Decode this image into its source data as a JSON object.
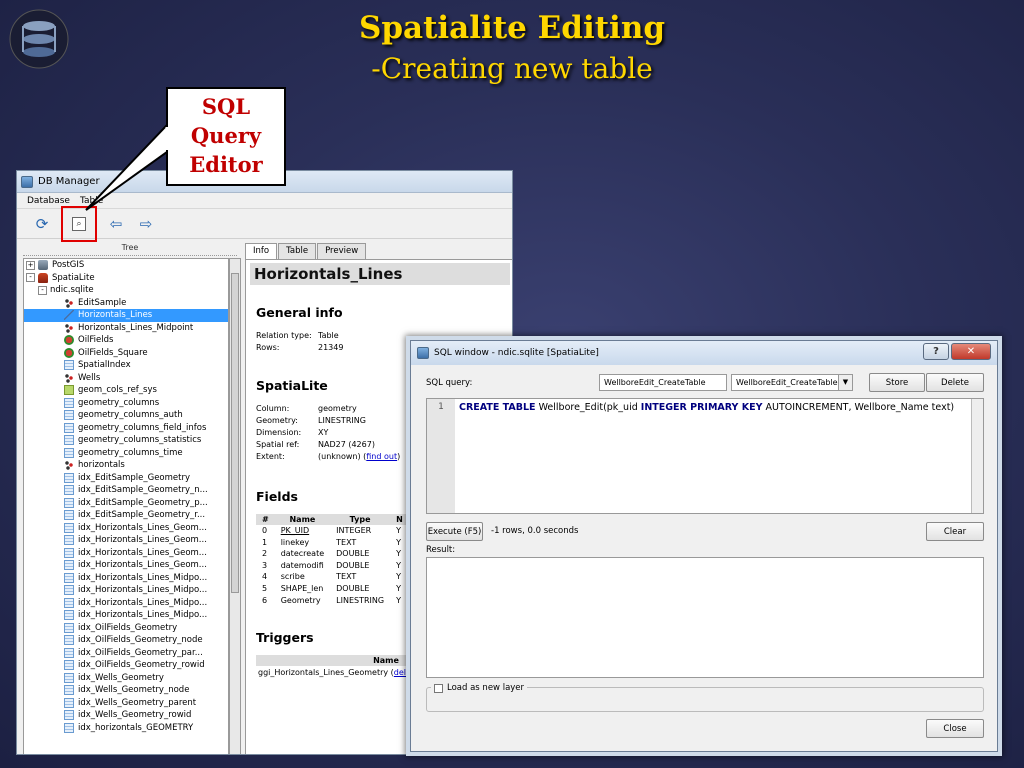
{
  "slide": {
    "title": "Spatialite Editing",
    "subtitle": "-Creating new table",
    "callout_lines": [
      "SQL",
      "Query",
      "Editor"
    ]
  },
  "db_manager": {
    "title": "DB Manager",
    "menu": [
      "Database",
      "Table"
    ],
    "tree_header": "Tree",
    "tree": [
      {
        "label": "PostGIS",
        "icon": "postgis-icon",
        "indent": 0,
        "expander": "+"
      },
      {
        "label": "SpatiaLite",
        "icon": "spatialite-icon",
        "indent": 0,
        "expander": "-"
      },
      {
        "label": "ndic.sqlite",
        "icon": "none",
        "indent": 1,
        "expander": "-"
      },
      {
        "label": "EditSample",
        "icon": "points-icon",
        "indent": 2
      },
      {
        "label": "Horizontals_Lines",
        "icon": "line-icon",
        "indent": 2,
        "selected": true
      },
      {
        "label": "Horizontals_Lines_Midpoint",
        "icon": "points-icon",
        "indent": 2
      },
      {
        "label": "OilFields",
        "icon": "polygon-icon",
        "indent": 2
      },
      {
        "label": "OilFields_Square",
        "icon": "polygon-icon",
        "indent": 2
      },
      {
        "label": "SpatialIndex",
        "icon": "table-icon",
        "indent": 2
      },
      {
        "label": "Wells",
        "icon": "points-icon",
        "indent": 2
      },
      {
        "label": "geom_cols_ref_sys",
        "icon": "geometry-icon",
        "indent": 2
      },
      {
        "label": "geometry_columns",
        "icon": "table-icon",
        "indent": 2
      },
      {
        "label": "geometry_columns_auth",
        "icon": "table-icon",
        "indent": 2
      },
      {
        "label": "geometry_columns_field_infos",
        "icon": "table-icon",
        "indent": 2
      },
      {
        "label": "geometry_columns_statistics",
        "icon": "table-icon",
        "indent": 2
      },
      {
        "label": "geometry_columns_time",
        "icon": "table-icon",
        "indent": 2
      },
      {
        "label": "horizontals",
        "icon": "points-icon",
        "indent": 2
      },
      {
        "label": "idx_EditSample_Geometry",
        "icon": "table-icon",
        "indent": 2
      },
      {
        "label": "idx_EditSample_Geometry_n...",
        "icon": "table-icon",
        "indent": 2
      },
      {
        "label": "idx_EditSample_Geometry_p...",
        "icon": "table-icon",
        "indent": 2
      },
      {
        "label": "idx_EditSample_Geometry_r...",
        "icon": "table-icon",
        "indent": 2
      },
      {
        "label": "idx_Horizontals_Lines_Geom...",
        "icon": "table-icon",
        "indent": 2
      },
      {
        "label": "idx_Horizontals_Lines_Geom...",
        "icon": "table-icon",
        "indent": 2
      },
      {
        "label": "idx_Horizontals_Lines_Geom...",
        "icon": "table-icon",
        "indent": 2
      },
      {
        "label": "idx_Horizontals_Lines_Geom...",
        "icon": "table-icon",
        "indent": 2
      },
      {
        "label": "idx_Horizontals_Lines_Midpo...",
        "icon": "table-icon",
        "indent": 2
      },
      {
        "label": "idx_Horizontals_Lines_Midpo...",
        "icon": "table-icon",
        "indent": 2
      },
      {
        "label": "idx_Horizontals_Lines_Midpo...",
        "icon": "table-icon",
        "indent": 2
      },
      {
        "label": "idx_Horizontals_Lines_Midpo...",
        "icon": "table-icon",
        "indent": 2
      },
      {
        "label": "idx_OilFields_Geometry",
        "icon": "table-icon",
        "indent": 2
      },
      {
        "label": "idx_OilFields_Geometry_node",
        "icon": "table-icon",
        "indent": 2
      },
      {
        "label": "idx_OilFields_Geometry_par...",
        "icon": "table-icon",
        "indent": 2
      },
      {
        "label": "idx_OilFields_Geometry_rowid",
        "icon": "table-icon",
        "indent": 2
      },
      {
        "label": "idx_Wells_Geometry",
        "icon": "table-icon",
        "indent": 2
      },
      {
        "label": "idx_Wells_Geometry_node",
        "icon": "table-icon",
        "indent": 2
      },
      {
        "label": "idx_Wells_Geometry_parent",
        "icon": "table-icon",
        "indent": 2
      },
      {
        "label": "idx_Wells_Geometry_rowid",
        "icon": "table-icon",
        "indent": 2
      },
      {
        "label": "idx_horizontals_GEOMETRY",
        "icon": "table-icon",
        "indent": 2
      }
    ],
    "tabs": [
      "Info",
      "Table",
      "Preview"
    ],
    "info": {
      "title": "Horizontals_Lines",
      "general_heading": "General info",
      "general": [
        {
          "k": "Relation type:",
          "v": "Table"
        },
        {
          "k": "Rows:",
          "v": "21349"
        }
      ],
      "spatialite_heading": "SpatiaLite",
      "spatialite": [
        {
          "k": "Column:",
          "v": "geometry"
        },
        {
          "k": "Geometry:",
          "v": "LINESTRING"
        },
        {
          "k": "Dimension:",
          "v": "XY"
        },
        {
          "k": "Spatial ref:",
          "v": "NAD27 (4267)"
        },
        {
          "k": "Extent:",
          "v": "(unknown)"
        }
      ],
      "find_out_link": "find out",
      "fields_heading": "Fields",
      "fields_columns": [
        "#",
        "Name",
        "Type",
        "N"
      ],
      "fields": [
        [
          "0",
          "PK_UID",
          "INTEGER",
          "Y"
        ],
        [
          "1",
          "linekey",
          "TEXT",
          "Y"
        ],
        [
          "2",
          "datecreate",
          "DOUBLE",
          "Y"
        ],
        [
          "3",
          "datemodifi",
          "DOUBLE",
          "Y"
        ],
        [
          "4",
          "scribe",
          "TEXT",
          "Y"
        ],
        [
          "5",
          "SHAPE_len",
          "DOUBLE",
          "Y"
        ],
        [
          "6",
          "Geometry",
          "LINESTRING",
          "Y"
        ]
      ],
      "triggers_heading": "Triggers",
      "triggers_column": "Name",
      "trigger_name": "ggi_Horizontals_Lines_Geometry",
      "delete_link": "delete"
    }
  },
  "sql_window": {
    "title": "SQL window - ndic.sqlite [SpatiaLite]",
    "help_label": "?",
    "close_x": "✕",
    "sql_query_label": "SQL query:",
    "query_name_value": "WellboreEdit_CreateTable",
    "query_select_value": "WellboreEdit_CreateTable",
    "store_label": "Store",
    "delete_label": "Delete",
    "line_number": "1",
    "code": {
      "kw1": "CREATE TABLE",
      "t1": " Wellbore_Edit(pk_uid ",
      "kw2": "INTEGER PRIMARY KEY",
      "t2": " AUTOINCREMENT, Wellbore_Name text)"
    },
    "execute_label": "Execute (F5)",
    "status": "-1 rows, 0.0 seconds",
    "clear_label": "Clear",
    "result_label": "Result:",
    "load_layer_label": "Load as new layer",
    "close_label": "Close"
  },
  "colors": {
    "title": "#ffd700",
    "callout_text": "#c00000",
    "selection": "#3399ff",
    "highlight_box": "#e00000"
  }
}
